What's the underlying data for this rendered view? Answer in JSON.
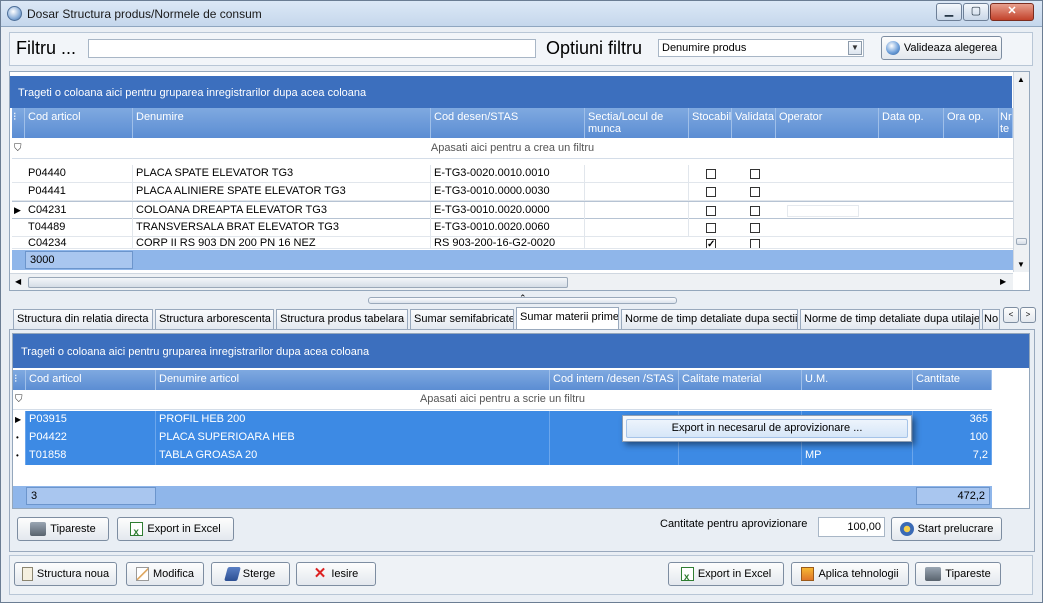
{
  "window": {
    "title": "Dosar Structura produs/Normele de consum",
    "minimize": "▁",
    "maximize": "▢",
    "close": "✕"
  },
  "filter_bar": {
    "filter_label": "Filtru ...",
    "filter_value": "",
    "options_label": "Optiuni filtru",
    "options_selected": "Denumire produs",
    "validate_button": "Valideaza alegerea"
  },
  "top_grid": {
    "group_hint": "Trageti o coloana aici pentru gruparea inregistrarilor dupa acea coloana",
    "filter_hint": "Apasati aici pentru a crea un filtru",
    "columns": [
      "Cod articol",
      "Denumire",
      "Cod desen/STAS",
      "Sectia/Locul de munca",
      "Stocabil",
      "Validata",
      "Operator",
      "Data op.",
      "Ora op.",
      "Nr te"
    ],
    "rows": [
      {
        "cod": "P04440",
        "denumire": "PLACA SPATE ELEVATOR TG3",
        "desen": "E-TG3-0020.0010.0010",
        "stocabil": false,
        "validata": false
      },
      {
        "cod": "P04441",
        "denumire": "PLACA ALINIERE SPATE ELEVATOR TG3",
        "desen": "E-TG3-0010.0000.0030",
        "stocabil": false,
        "validata": false
      },
      {
        "cod": "C04231",
        "denumire": "COLOANA DREAPTA ELEVATOR TG3",
        "desen": "E-TG3-0010.0020.0000",
        "stocabil": false,
        "validata": false
      },
      {
        "cod": "T04489",
        "denumire": "TRANSVERSALA BRAT ELEVATOR TG3",
        "desen": "E-TG3-0010.0020.0060",
        "stocabil": false,
        "validata": false
      },
      {
        "cod": "C04234",
        "denumire": "CORP II RS 903 DN 200 PN 16 NEZ",
        "desen": "RS 903-200-16-G2-0020",
        "stocabil": true,
        "validata": false
      }
    ],
    "footer_count": "3000"
  },
  "tabs": [
    "Structura din relatia directa",
    "Structura arborescenta",
    "Structura produs tabelara",
    "Sumar semifabricate",
    "Sumar materii prime",
    "Norme de timp detaliate dupa sectii",
    "Norme de timp detaliate dupa utilaje",
    "No"
  ],
  "active_tab": "Sumar materii prime",
  "bottom_grid": {
    "group_hint": "Trageti o coloana aici pentru gruparea inregistrarilor dupa acea coloana",
    "filter_hint": "Apasati aici pentru a scrie un filtru",
    "columns": [
      "Cod articol",
      "Denumire articol",
      "Cod intern /desen /STAS",
      "Calitate material",
      "U.M.",
      "Cantitate"
    ],
    "rows": [
      {
        "cod": "P03915",
        "denumire": "PROFIL HEB 200",
        "um": "",
        "cantitate": "365"
      },
      {
        "cod": "P04422",
        "denumire": "PLACA SUPERIOARA HEB",
        "um": "",
        "cantitate": "100"
      },
      {
        "cod": "T01858",
        "denumire": "TABLA GROASA 20",
        "um": "MP",
        "cantitate": "7,2"
      }
    ],
    "footer_count": "3",
    "footer_total": "472,2"
  },
  "context_menu": {
    "item": "Export in necesarul de aprovizionare ..."
  },
  "tab_actions": {
    "print": "Tipareste",
    "export_excel": "Export in Excel",
    "quantity_label": "Cantitate pentru aprovizionare",
    "quantity_value": "100,00",
    "start": "Start prelucrare"
  },
  "bottom_actions": {
    "new_structure": "Structura noua",
    "modify": "Modifica",
    "delete": "Sterge",
    "exit": "Iesire",
    "export_excel": "Export in Excel",
    "apply_tech": "Aplica tehnologii",
    "print": "Tipareste"
  },
  "colors": {
    "group_band": "#3c6fbe",
    "header": "#5b8dd3",
    "selection": "#3d8ae4",
    "footer": "#8fb6ea"
  }
}
